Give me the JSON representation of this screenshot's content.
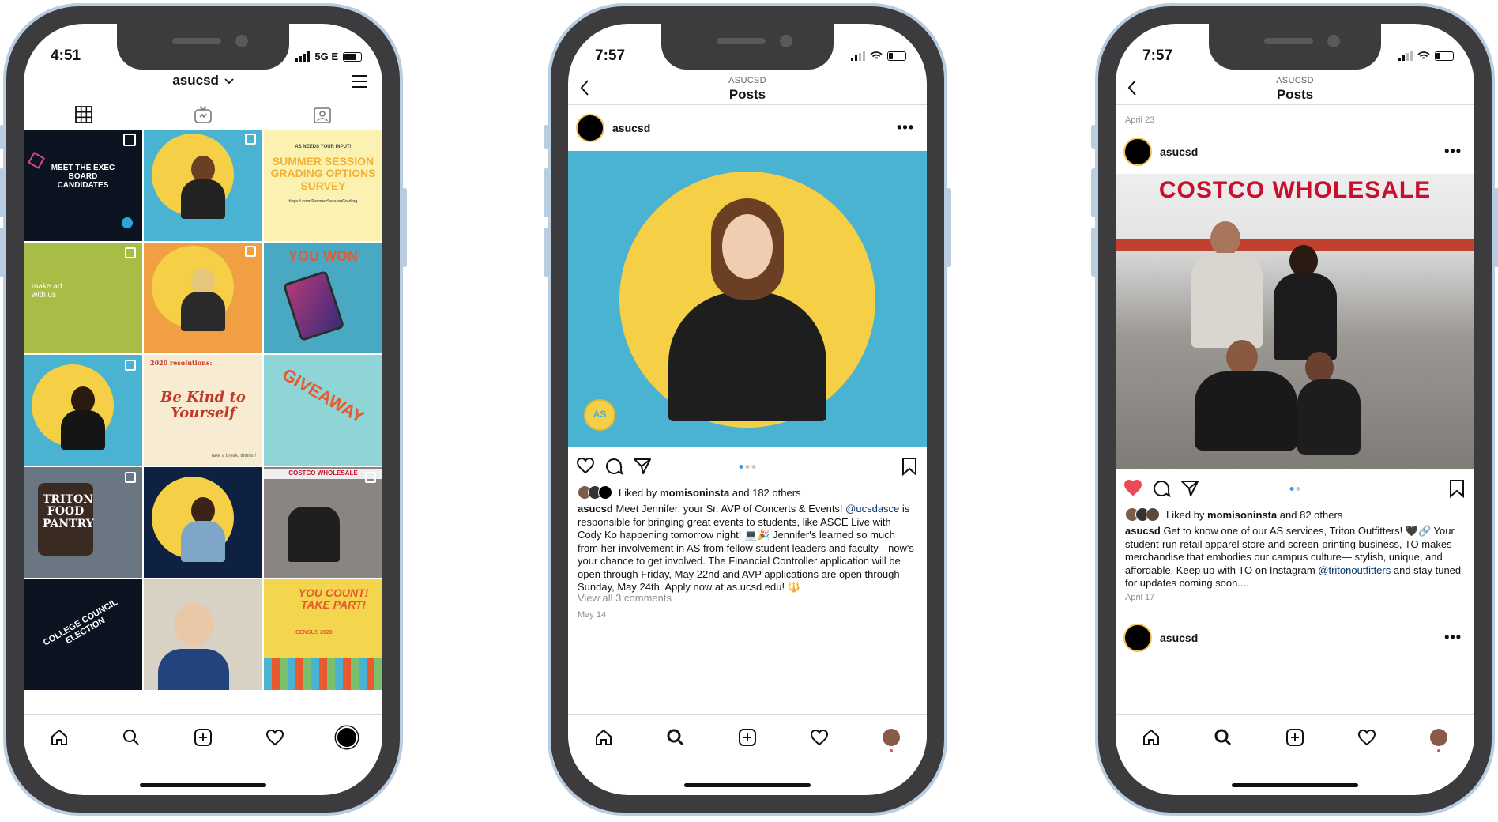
{
  "phone1": {
    "status": {
      "time": "4:51",
      "network": "5G E"
    },
    "profile": {
      "username": "asucsd"
    },
    "grid": {
      "tile1": {
        "text": "MEET THE EXEC BOARD CANDIDATES"
      },
      "tile3": {
        "header": "AS NEEDS YOUR INPUT!",
        "text": "SUMMER SESSION GRADING OPTIONS SURVEY",
        "link": "tinyurl.com/SummerSessionGrading"
      },
      "tile4": {
        "text": "make art with us"
      },
      "tile6": {
        "text": "YOU WON"
      },
      "tile8": {
        "header": "2020 resolutions:",
        "text": "Be Kind to Yourself",
        "footer": "take a break, tritons !"
      },
      "tile9": {
        "text": "GIVEAWAY"
      },
      "tile10": {
        "text": "TRITON FOOD PANTRY"
      },
      "tile12": {
        "text": "COSTCO WHOLESALE"
      },
      "tile13": {
        "text": "COLLEGE COUNCIL ELECTION"
      },
      "tile15": {
        "text": "YOU COUNT! TAKE PART!",
        "sub": "CENSUS 2020"
      }
    }
  },
  "phone2": {
    "status": {
      "time": "7:57"
    },
    "nav": {
      "subtitle": "ASUCSD",
      "title": "Posts"
    },
    "post": {
      "username": "asucsd",
      "liked_prefix": "Liked by",
      "liked_user": "momisoninsta",
      "liked_suffix": "and 182 others",
      "caption_user": "asucsd",
      "caption_1": "Meet Jennifer, your Sr. AVP of Concerts & Events!",
      "mention": "@ucsdasce",
      "caption_2": "is responsible for bringing great events to students, like ASCE Live with Cody Ko happening tomorrow night! 💻🎉 Jennifer's learned so much from her involvement in AS from fellow student leaders and faculty-- now's your chance to get involved. The Financial Controller application will be open through Friday, May 22nd and AVP applications are open through Sunday, May 24th. Apply now at as.ucsd.edu! 🔱",
      "view_comments": "View all 3 comments",
      "date": "May 14"
    }
  },
  "phone3": {
    "status": {
      "time": "7:57"
    },
    "nav": {
      "subtitle": "ASUCSD",
      "title": "Posts"
    },
    "prev_date": "April 23",
    "post": {
      "username": "asucsd",
      "image_sign": "COSTCO WHOLESALE",
      "liked_prefix": "Liked by",
      "liked_user": "momisoninsta",
      "liked_suffix": "and 82 others",
      "caption_user": "asucsd",
      "caption_1": "Get to know one of our AS services, Triton Outfitters! 🖤🔗 Your student-run retail apparel store and screen-printing business, TO makes merchandise that embodies our campus culture— stylish, unique, and affordable. Keep up with TO on Instagram",
      "mention": "@tritonoutfitters",
      "caption_2": "and stay tuned for updates coming soon....",
      "date": "April 17"
    },
    "next_username": "asucsd"
  },
  "colors": {
    "frame": "#b9cde0",
    "body": "#3c3c3e",
    "post_bg": "#4ab3d1",
    "circle": "#f5cf45",
    "like": "#ed4956"
  }
}
